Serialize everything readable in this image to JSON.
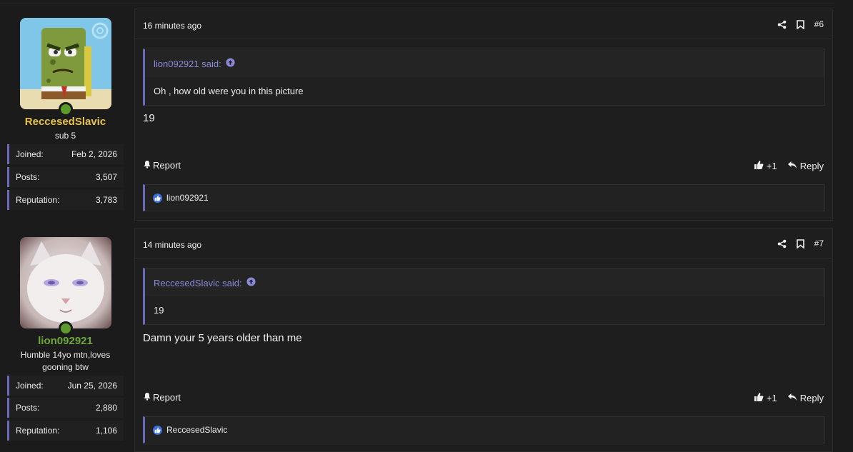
{
  "colors": {
    "accent": "#6a6ab8",
    "quote_link": "#8a8ad8",
    "user1_name": "#e8c34a",
    "user2_name": "#6fa83a",
    "online": "#5b9a2b"
  },
  "posts": [
    {
      "user": {
        "name": "ReccesedSlavic",
        "title": "sub 5",
        "joined_label": "Joined:",
        "joined": "Feb 2, 2026",
        "posts_label": "Posts:",
        "posts": "3,507",
        "rep_label": "Reputation:",
        "reputation": "3,783",
        "avatar": "spongebob-avatar"
      },
      "time": "16 minutes ago",
      "number": "#6",
      "quote": {
        "author": "lion092921 said:",
        "text": "Oh , how old were you in this picture"
      },
      "body": "19",
      "report_label": "Report",
      "like_count": "+1",
      "reply_label": "Reply",
      "liked_by": "lion092921"
    },
    {
      "user": {
        "name": "lion092921",
        "title": "Humble 14yo mtn,loves gooning btw",
        "joined_label": "Joined:",
        "joined": "Jun 25, 2026",
        "posts_label": "Posts:",
        "posts": "2,880",
        "rep_label": "Reputation:",
        "reputation": "1,106",
        "avatar": "white-cat-avatar"
      },
      "time": "14 minutes ago",
      "number": "#7",
      "quote": {
        "author": "ReccesedSlavic said:",
        "text": "19"
      },
      "body": "Damn your 5 years older than me",
      "report_label": "Report",
      "like_count": "+1",
      "reply_label": "Reply",
      "liked_by": "ReccesedSlavic"
    }
  ]
}
